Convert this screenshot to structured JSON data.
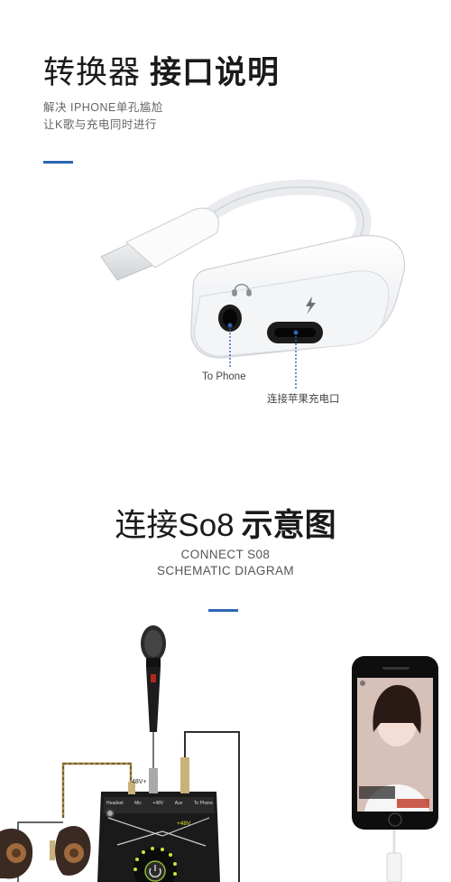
{
  "section1": {
    "title_light": "转换器",
    "title_bold": "接口说明",
    "line1": "解决 IPHONE单孔尴尬",
    "line2": "让K歌与充电同时进行",
    "label_phone": "To Phone",
    "label_charge": "连接苹果充电口"
  },
  "section2": {
    "title_light": "连接So8",
    "title_bold": "示意图",
    "en_line1": "CONNECT S08",
    "en_line2": "SCHEMATIC DIAGRAM"
  },
  "device_labels": {
    "label_48v": "48V+",
    "label_plus48v": "+48V",
    "ports": [
      "Headset",
      "Mic",
      "+48V",
      "Aux",
      "To Phone"
    ]
  },
  "colors": {
    "accent": "#2d66b3",
    "cable": "#2f2f2f"
  },
  "icons": [
    "headphone-icon",
    "lightning-icon",
    "power-icon"
  ]
}
